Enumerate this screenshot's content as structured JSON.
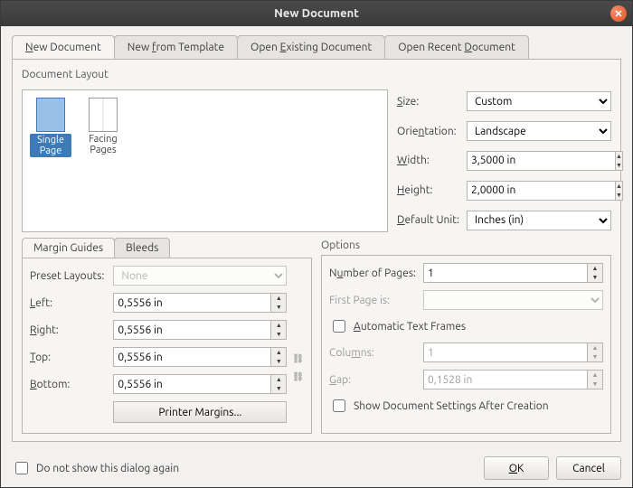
{
  "title": "New Document",
  "tabs": {
    "new_doc": "New Document",
    "from_template": "New from Template",
    "open_existing": "Open Existing Document",
    "open_recent": "Open Recent Document"
  },
  "layout": {
    "section": "Document Layout",
    "single": "Single Page",
    "facing": "Facing Pages"
  },
  "size": {
    "size_label": "Size:",
    "size_value": "Custom",
    "orient_label": "Orientation:",
    "orient_value": "Landscape",
    "width_label": "Width:",
    "width_value": "3,5000 in",
    "height_label": "Height:",
    "height_value": "2,0000 in",
    "unit_label": "Default Unit:",
    "unit_value": "Inches (in)"
  },
  "margins": {
    "tab_margins": "Margin Guides",
    "tab_bleeds": "Bleeds",
    "preset_label": "Preset Layouts:",
    "preset_value": "None",
    "left_label": "Left:",
    "left_value": "0,5556 in",
    "right_label": "Right:",
    "right_value": "0,5556 in",
    "top_label": "Top:",
    "top_value": "0,5556 in",
    "bottom_label": "Bottom:",
    "bottom_value": "0,5556 in",
    "printer_btn": "Printer Margins..."
  },
  "options": {
    "section": "Options",
    "num_pages_label": "Number of Pages:",
    "num_pages_value": "1",
    "first_page_label": "First Page is:",
    "first_page_value": "",
    "auto_frames": "Automatic Text Frames",
    "columns_label": "Columns:",
    "columns_value": "1",
    "gap_label": "Gap:",
    "gap_value": "0,1528 in",
    "show_settings": "Show Document Settings After Creation"
  },
  "footer": {
    "dont_show": "Do not show this dialog again",
    "ok": "OK",
    "cancel": "Cancel"
  }
}
